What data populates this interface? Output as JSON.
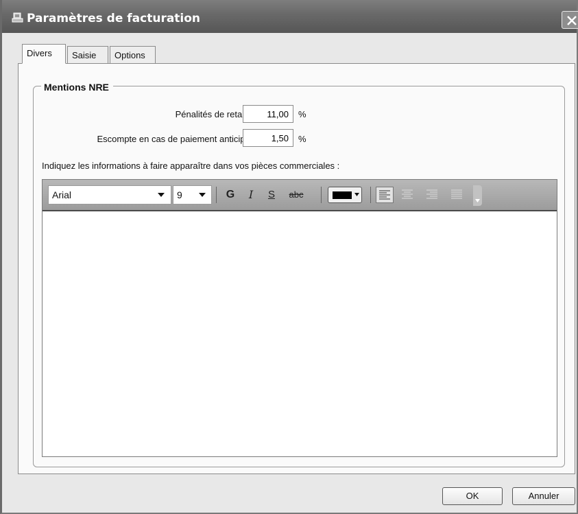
{
  "window": {
    "title": "Paramètres de facturation"
  },
  "tabs": [
    {
      "label": "Divers",
      "active": true
    },
    {
      "label": "Saisie",
      "active": false
    },
    {
      "label": "Options",
      "active": false
    }
  ],
  "group": {
    "title": "Mentions NRE",
    "penalites": {
      "label": "Pénalités de retard :",
      "value": "11,00",
      "unit": "%"
    },
    "escompte": {
      "label": "Escompte en cas de paiement anticipé :",
      "value": "1,50",
      "unit": "%"
    },
    "info_label": "Indiquez les informations à faire apparaître dans vos pièces commerciales :"
  },
  "editor": {
    "font": "Arial",
    "size": "9",
    "bold_label": "G",
    "italic_label": "I",
    "underline_label": "S",
    "strike_label": "abc",
    "text_color": "#000000",
    "content": ""
  },
  "buttons": {
    "ok": "OK",
    "cancel": "Annuler"
  }
}
